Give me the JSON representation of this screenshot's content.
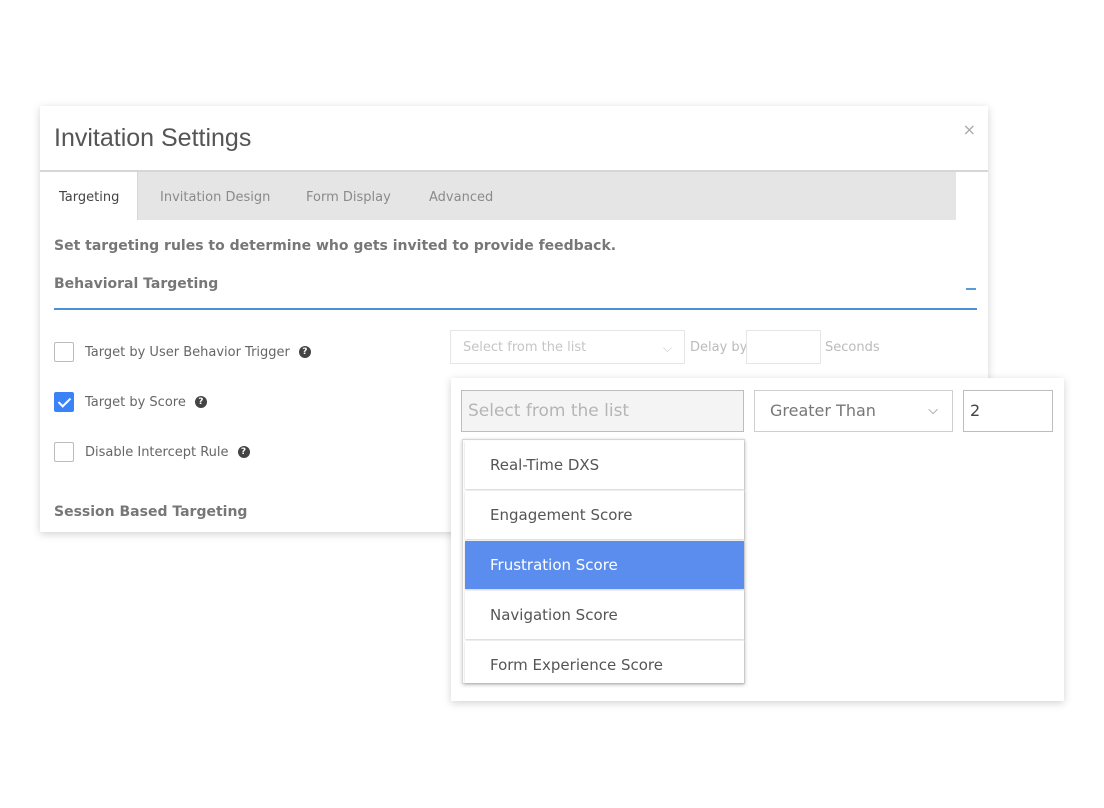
{
  "modal": {
    "title": "Invitation Settings",
    "close": "×",
    "tabs": [
      {
        "label": "Targeting",
        "active": true
      },
      {
        "label": "Invitation Design",
        "active": false
      },
      {
        "label": "Form Display",
        "active": false
      },
      {
        "label": "Advanced",
        "active": false
      }
    ],
    "description": "Set targeting rules to determine who gets invited to provide feedback.",
    "behavioral": {
      "title": "Behavioral Targeting",
      "collapse_icon": "minus-icon",
      "options": [
        {
          "label": "Target by User Behavior Trigger",
          "checked": false,
          "help_icon": "question-circle-icon",
          "help_glyph": "?"
        },
        {
          "label": "Target by Score",
          "checked": true,
          "help_icon": "question-circle-icon",
          "help_glyph": "?"
        },
        {
          "label": "Disable Intercept Rule",
          "checked": false,
          "help_icon": "question-circle-icon",
          "help_glyph": "?"
        }
      ],
      "trigger_select_placeholder": "Select from the list",
      "delay_label": "Delay by",
      "delay_value": "",
      "seconds_label": "Seconds"
    },
    "session_title": "Session Based Targeting"
  },
  "score_panel": {
    "score_select_placeholder": "Select from the list",
    "comparator_value": "Greater Than",
    "threshold_value": "2",
    "dropdown_options": [
      {
        "label": "Real-Time DXS",
        "highlighted": false
      },
      {
        "label": "Engagement Score",
        "highlighted": false
      },
      {
        "label": "Frustration Score",
        "highlighted": true
      },
      {
        "label": "Navigation Score",
        "highlighted": false
      },
      {
        "label": "Form Experience Score",
        "highlighted": false
      }
    ]
  },
  "colors": {
    "accent": "#3b82f6",
    "highlight": "#5b8def",
    "section_rule": "#4a90d9"
  }
}
